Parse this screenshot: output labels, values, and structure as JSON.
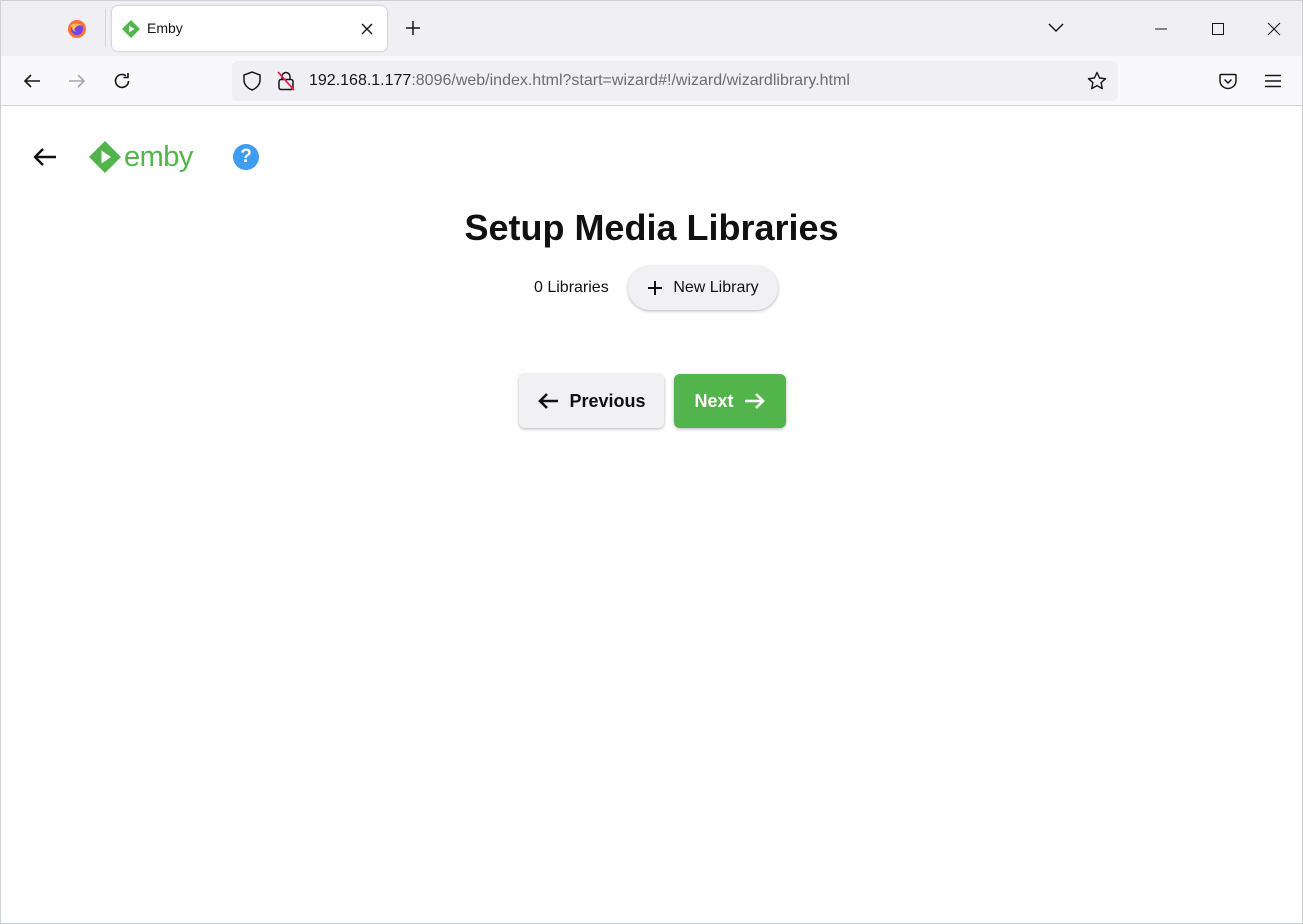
{
  "browser": {
    "tab": {
      "title": "Emby"
    },
    "url": {
      "host": "192.168.1.177",
      "rest": ":8096/web/index.html?start=wizard#!/wizard/wizardlibrary.html"
    }
  },
  "app": {
    "logo_text": "emby",
    "help_symbol": "?",
    "brand_color": "#52b54b",
    "help_color": "#3f9df0"
  },
  "wizard": {
    "title": "Setup Media Libraries",
    "library_count": "0 Libraries",
    "new_library_label": "New Library",
    "previous_label": "Previous",
    "next_label": "Next"
  }
}
